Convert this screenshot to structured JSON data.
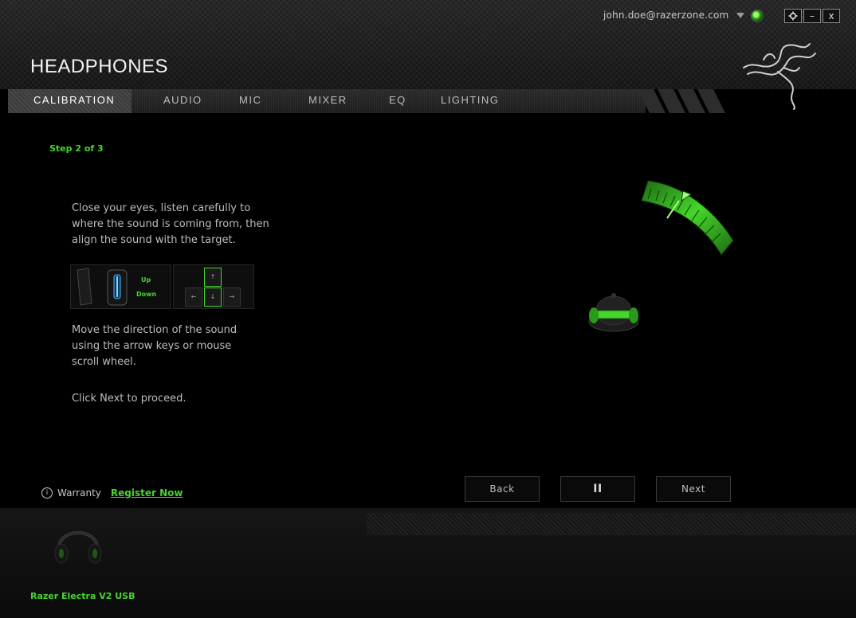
{
  "account": {
    "email": "john.doe@razerzone.com"
  },
  "window": {
    "settings_icon": "gear-icon",
    "minimize": "–",
    "close": "x"
  },
  "page_title": "HEADPHONES",
  "tabs": [
    {
      "label": "CALIBRATION",
      "active": true
    },
    {
      "label": "AUDIO",
      "active": false
    },
    {
      "label": "MIC",
      "active": false
    },
    {
      "label": "MIXER",
      "active": false
    },
    {
      "label": "EQ",
      "active": false
    },
    {
      "label": "LIGHTING",
      "active": false
    }
  ],
  "calibration": {
    "step": "Step 2 of 3",
    "instruction_lines": [
      "Close your eyes, listen carefully to",
      "where the sound is coming from, then",
      "align the sound with the target."
    ],
    "mouse_hint": {
      "up": "Up",
      "down": "Down"
    },
    "key_arrows": {
      "up": "↑",
      "down": "↓",
      "left": "←",
      "right": "→"
    },
    "move_lines": [
      "Move the direction of the sound",
      "using the arrow keys or mouse",
      "scroll wheel."
    ],
    "proceed": "Click Next to proceed."
  },
  "warranty": {
    "label": "Warranty",
    "link": "Register Now"
  },
  "buttons": {
    "back": "Back",
    "pause": "II",
    "next": "Next"
  },
  "device": {
    "name": "Razer Electra V2 USB"
  },
  "colors": {
    "accent": "#44d62c",
    "background": "#000000"
  }
}
